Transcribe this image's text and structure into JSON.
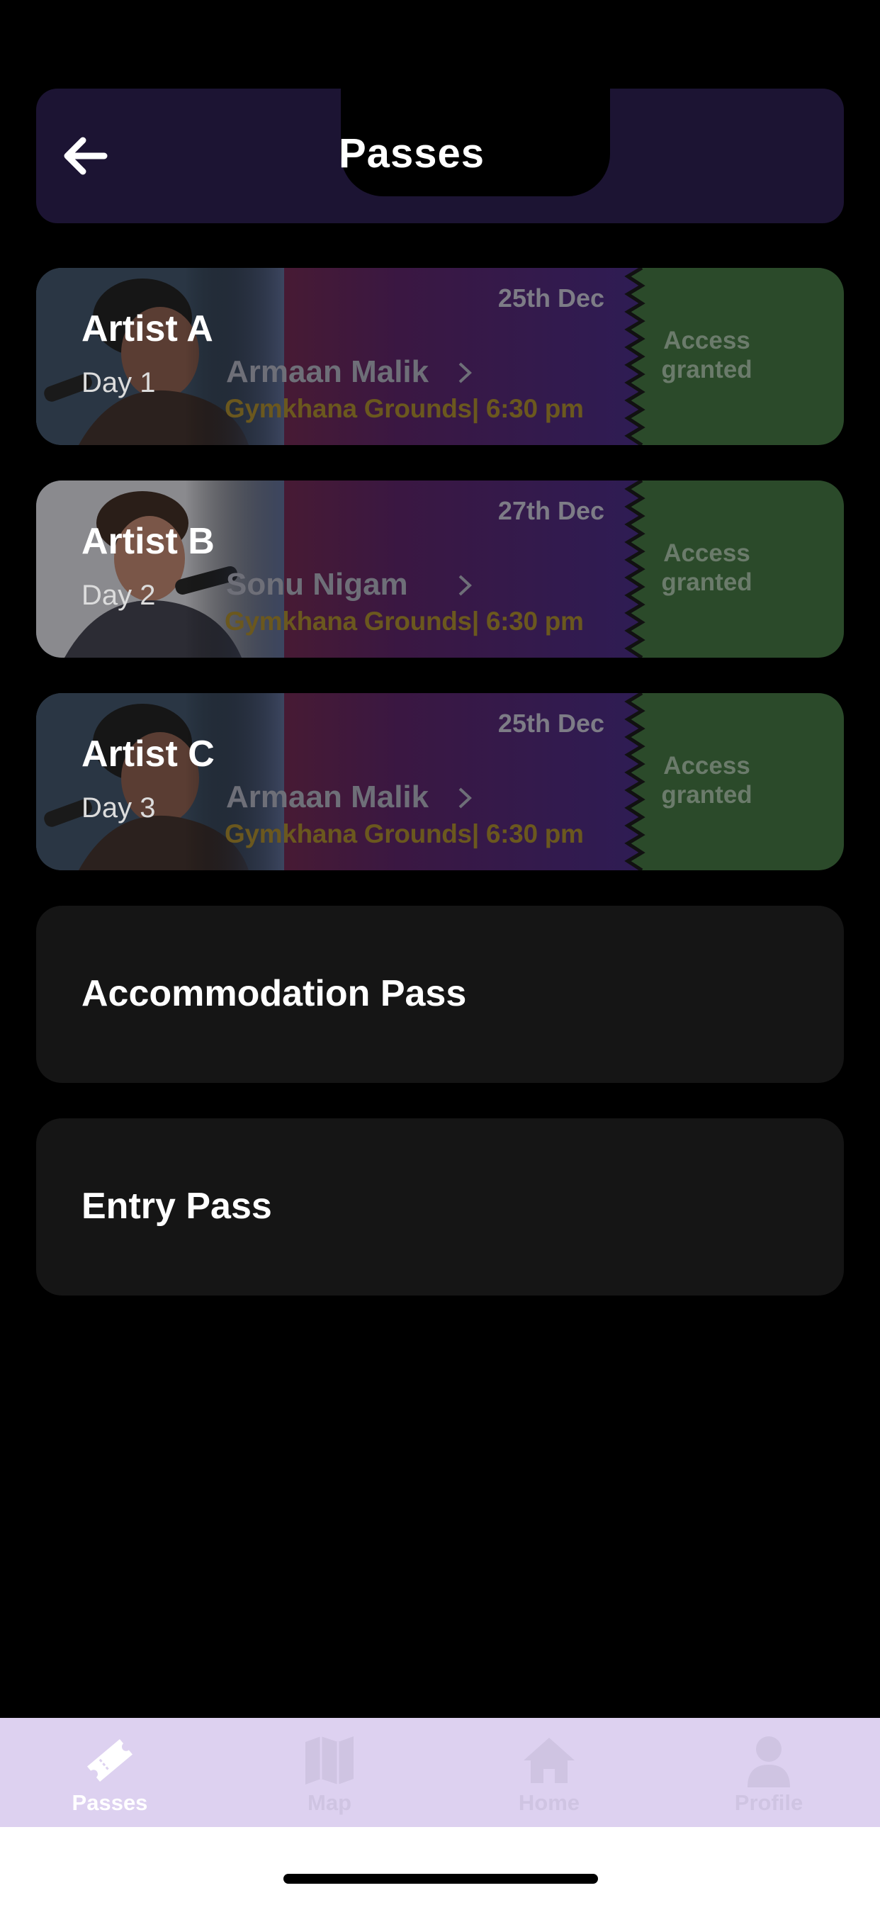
{
  "header": {
    "title": "Passes"
  },
  "tickets": [
    {
      "title": "Artist A",
      "day": "Day 1",
      "date": "25th Dec",
      "performer": "Armaan Malik",
      "venue": "Gymkhana Grounds| 6:30 pm",
      "status": "Access granted"
    },
    {
      "title": "Artist B",
      "day": "Day 2",
      "date": "27th Dec",
      "performer": "Sonu Nigam",
      "venue": "Gymkhana Grounds| 6:30 pm",
      "status": "Access granted"
    },
    {
      "title": "Artist C",
      "day": "Day 3",
      "date": "25th Dec",
      "performer": "Armaan Malik",
      "venue": "Gymkhana Grounds| 6:30 pm",
      "status": "Access granted"
    }
  ],
  "passes": [
    {
      "label": "Accommodation Pass"
    },
    {
      "label": "Entry Pass"
    }
  ],
  "tabbar": {
    "tabs": [
      {
        "label": "Passes",
        "icon": "ticket-icon",
        "active": true
      },
      {
        "label": "Map",
        "icon": "map-icon",
        "active": false
      },
      {
        "label": "Home",
        "icon": "home-icon",
        "active": false
      },
      {
        "label": "Profile",
        "icon": "profile-icon",
        "active": false
      }
    ]
  },
  "colors": {
    "header_bg": "#1c1433",
    "stub_bg": "#2b4a2a",
    "tabbar_bg": "#ddd1f0",
    "tab_active": "#ffffff",
    "tab_inactive": "#cfc4e2"
  }
}
